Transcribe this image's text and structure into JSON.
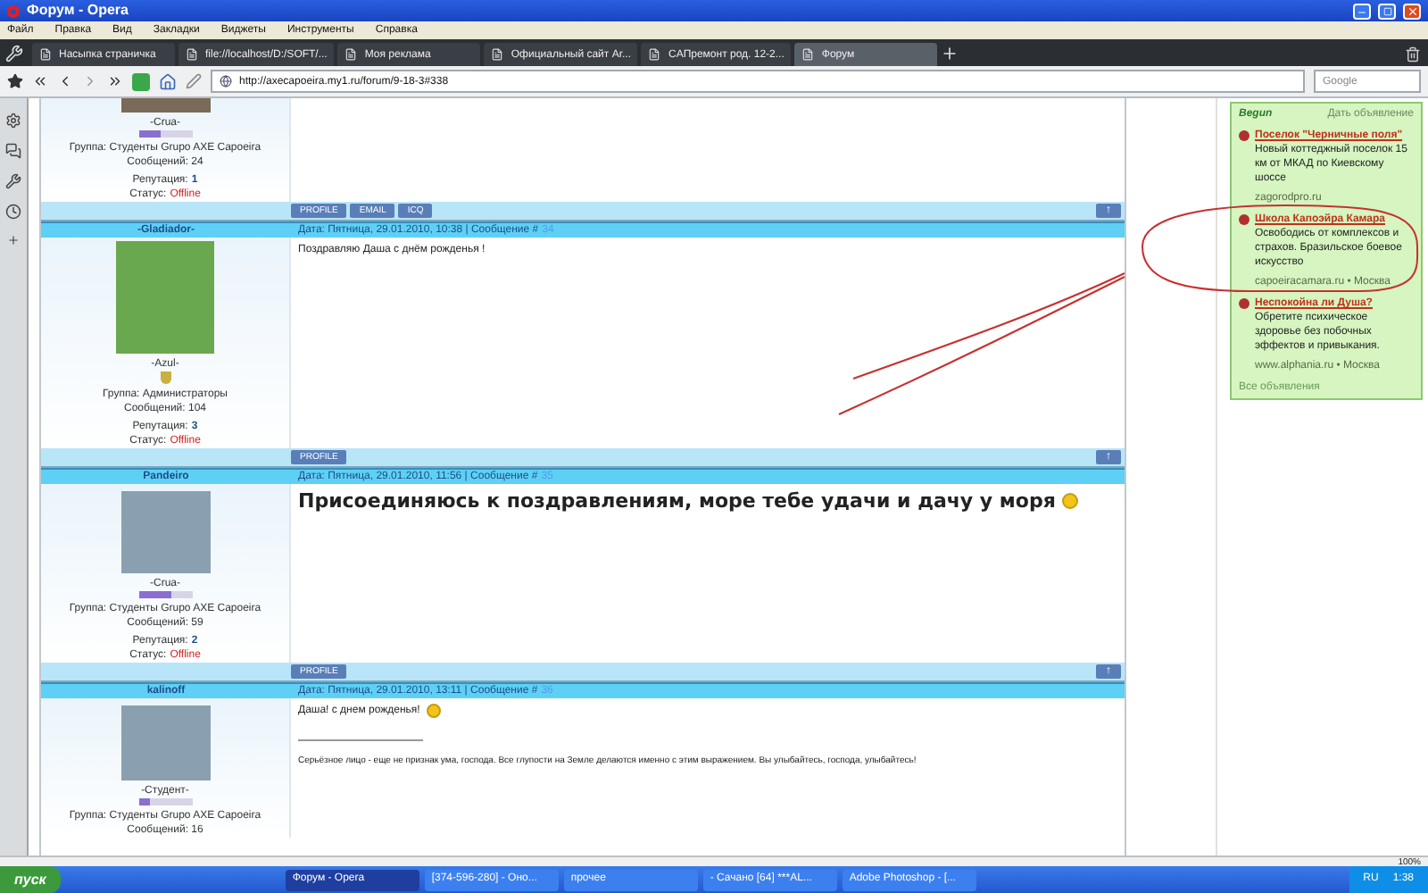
{
  "window": {
    "title": "Форум - Opera"
  },
  "menu": [
    "Файл",
    "Правка",
    "Вид",
    "Закладки",
    "Виджеты",
    "Инструменты",
    "Справка"
  ],
  "tabs": [
    {
      "label": "Насыпка страничка",
      "selected": false
    },
    {
      "label": "file://localhost/D:/SOFT/...",
      "selected": false
    },
    {
      "label": "Моя реклама",
      "selected": false
    },
    {
      "label": "Официальный сайт Ar...",
      "selected": false
    },
    {
      "label": "CAПремонт род. 12-2...",
      "selected": false
    },
    {
      "label": "Форум",
      "selected": true
    }
  ],
  "address_bar": {
    "url": "http://axecapoeira.my1.ru/forum/9-18-3#338"
  },
  "search": {
    "placeholder": "Google"
  },
  "posts": [
    {
      "user": {
        "rank": "-Crua-",
        "level": 0.4,
        "group": "Группа: Студенты Grupo AXE Capoeira",
        "count": "Сообщений: 24",
        "reputation_label": "Репутация:",
        "reputation": "1",
        "status_label": "Статус:",
        "status": "Offline"
      },
      "buttons": [
        "PROFILE",
        "EMAIL",
        "ICQ"
      ],
      "up": "↑"
    },
    {
      "author": "-Gladiador-",
      "date": "Дата: Пятница, 29.01.2010, 10:38 | Сообщение #",
      "number": "34",
      "kind": "normal",
      "text": "Поздравляю Даша с днём рожденья !",
      "smile": false,
      "user": {
        "rank": "-Azul-",
        "badge": true,
        "group": "Группа: Администраторы",
        "count": "Сообщений: 104",
        "reputation_label": "Репутация:",
        "reputation": "3",
        "status_label": "Статус:",
        "status": "Offline"
      },
      "buttons": [
        "PROFILE"
      ],
      "up": "↑"
    },
    {
      "author": "Pandeiro",
      "date": "Дата: Пятница, 29.01.2010, 11:56 | Сообщение #",
      "number": "35",
      "kind": "large",
      "text": "Присоединяюсь к поздравлениям, море тебе удачи и дачу у моря",
      "smile": true,
      "user": {
        "rank": "-Crua-",
        "level": 0.6,
        "group": "Группа: Студенты Grupo AXE Capoeira",
        "count": "Сообщений: 59",
        "reputation_label": "Репутация:",
        "reputation": "2",
        "status_label": "Статус:",
        "status": "Offline"
      },
      "buttons": [
        "PROFILE"
      ],
      "up": "↑"
    },
    {
      "author": "kalinoff",
      "date": "Дата: Пятница, 29.01.2010, 13:11 | Сообщение #",
      "number": "36",
      "kind": "normal",
      "text": "Даша! с днем рожденья!",
      "smile": true,
      "signature": "Серьёзное лицо - еще не признак ума, господа. Все глупости на Земле делаются именно с этим выражением. Вы улыбайтесь, господа, улыбайтесь!",
      "user": {
        "rank": "-Студент-",
        "level": 0.2,
        "group": "Группа: Студенты Grupo AXE Capoeira",
        "count": "Сообщений: 16"
      }
    }
  ],
  "ads": {
    "brand": "Begun",
    "add_link": "Дать объявление",
    "items": [
      {
        "title": "Поселок \"Черничные поля\"",
        "text": "Новый коттеджный поселок 15 км от МКАД по Киевскому шоссе",
        "url": "zagorodpro.ru"
      },
      {
        "title": "Школа Капоэйра Камара",
        "text": "Освободись от комплексов и страхов. Бразильское боевое искусство",
        "url": "capoeiracamara.ru • Москва"
      },
      {
        "title": "Неспокойна ли Душа?",
        "text": "Обретите психическое здоровье без побочных эффектов и привыкания.",
        "url": "www.alphania.ru • Москва"
      }
    ],
    "all_link": "Все объявления"
  },
  "zoom": "100%",
  "taskbar": {
    "start": "пуск",
    "tasks": [
      {
        "label": "Форум - Opera",
        "selected": true
      },
      {
        "label": "[374-596-280] - Оно...",
        "selected": false
      },
      {
        "label": "прочее",
        "selected": false
      },
      {
        "label": "- Сачано [64] ***AL...",
        "selected": false
      },
      {
        "label": "Adobe Photoshop - [...",
        "selected": false
      }
    ],
    "lang": "RU",
    "time": "1:38"
  }
}
